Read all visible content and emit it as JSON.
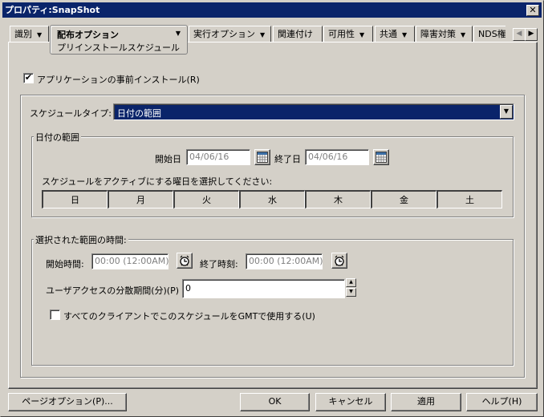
{
  "window": {
    "title": "プロパティ:SnapShot",
    "close_label": "✕"
  },
  "tabs": [
    {
      "label": "識別",
      "has_menu": true
    },
    {
      "label": "配布オプション",
      "subtitle": "プリインストールスケジュール",
      "has_menu": true,
      "active": true
    },
    {
      "label": "実行オプション",
      "has_menu": true
    },
    {
      "label": "関連付け",
      "has_menu": false
    },
    {
      "label": "可用性",
      "has_menu": true
    },
    {
      "label": "共通",
      "has_menu": true
    },
    {
      "label": "障害対策",
      "has_menu": true
    },
    {
      "label": "NDS権",
      "has_menu": false
    }
  ],
  "tab_scroll": {
    "left": "◀",
    "right": "▶"
  },
  "icons": {
    "dropdown_arrow": "▼",
    "check": "✔",
    "spin_up": "▲",
    "spin_down": "▼"
  },
  "preinstall": {
    "label": "アプリケーションの事前インストール(R)",
    "checked": true
  },
  "schedule": {
    "type_label": "スケジュールタイプ:",
    "type_value": "日付の範囲"
  },
  "date_range": {
    "group_title": "日付の範囲",
    "start_label": "開始日",
    "start_value": "04/06/16",
    "end_label": "終了日",
    "end_value": "04/06/16",
    "days_prompt": "スケジュールをアクティブにする曜日を選択してください:",
    "days": [
      "日",
      "月",
      "火",
      "水",
      "木",
      "金",
      "土"
    ]
  },
  "time_range": {
    "group_title": "選択された範囲の時間:",
    "start_label": "開始時間:",
    "start_value": "00:00 (12:00AM)",
    "end_label": "終了時刻:",
    "end_value": "00:00 (12:00AM)",
    "spread_label": "ユーザアクセスの分散期間(分)(P)",
    "spread_value": "0",
    "gmt_label": "すべてのクライアントでこのスケジュールをGMTで使用する(U)",
    "gmt_checked": false
  },
  "footer": {
    "page_options": "ページオプション(P)...",
    "ok": "OK",
    "cancel": "キャンセル",
    "apply": "適用",
    "help": "ヘルプ(H)"
  },
  "colors": {
    "face": "#d4d0c8",
    "titlebar": "#0a246a",
    "selection": "#0a246a",
    "disabled_text": "#808080"
  }
}
